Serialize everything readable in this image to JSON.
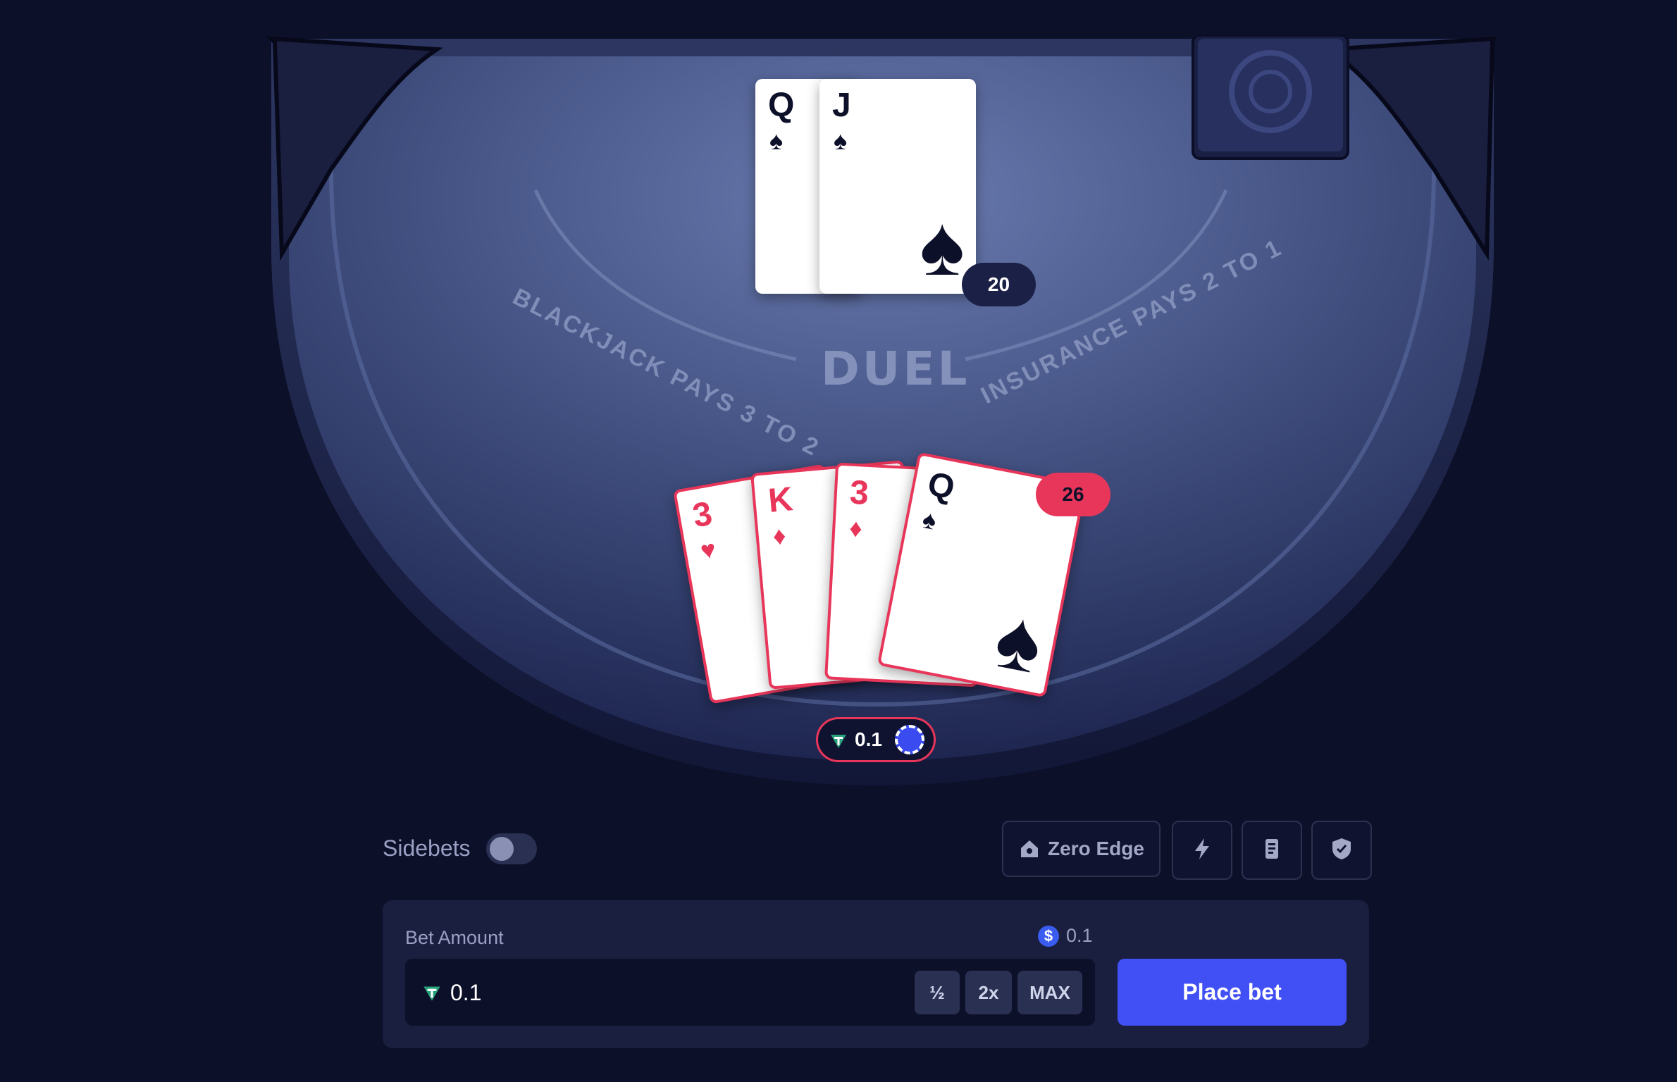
{
  "table": {
    "left_arc_text": "BLACKJACK PAYS 3 TO 2",
    "center_logo": "DUEL",
    "right_arc_text": "INSURANCE PAYS 2 TO 1"
  },
  "dealer": {
    "cards": [
      {
        "rank": "Q",
        "suit": "♠"
      },
      {
        "rank": "J",
        "suit": "♠"
      }
    ],
    "score": "20"
  },
  "player": {
    "cards": [
      {
        "rank": "3",
        "suit": "♥"
      },
      {
        "rank": "K",
        "suit": "♦"
      },
      {
        "rank": "3",
        "suit": "♦"
      },
      {
        "rank": "Q",
        "suit": "♠"
      }
    ],
    "score": "26",
    "bet_chip_value": "0.1"
  },
  "controls": {
    "sidebets_label": "Sidebets",
    "sidebets_enabled": false,
    "zero_edge_label": "Zero Edge",
    "icons": [
      "house-icon",
      "lightning-icon",
      "receipt-icon",
      "shield-check-icon"
    ]
  },
  "bet_panel": {
    "bet_amount_label": "Bet Amount",
    "usd_value": "0.1",
    "input_value": "0.1",
    "half_label": "½",
    "double_label": "2x",
    "max_label": "MAX",
    "place_bet_label": "Place bet"
  },
  "colors": {
    "background": "#0d1029",
    "table_felt": "#3e4c7c",
    "accent_red": "#e8365a",
    "place_bet": "#4150f5",
    "panel": "#1a1f3f"
  }
}
